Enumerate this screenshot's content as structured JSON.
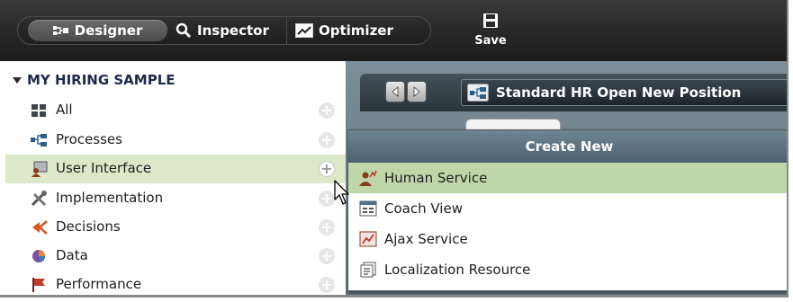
{
  "toolbar": {
    "modes": [
      {
        "label": "Designer",
        "icon": "designer-icon"
      },
      {
        "label": "Inspector",
        "icon": "magnifier-icon"
      },
      {
        "label": "Optimizer",
        "icon": "optimizer-icon"
      }
    ],
    "save_label": "Save"
  },
  "library": {
    "section_title": "MY HIRING SAMPLE",
    "items": [
      {
        "label": "All",
        "icon": "grid-icon"
      },
      {
        "label": "Processes",
        "icon": "process-icon"
      },
      {
        "label": "User Interface",
        "icon": "user-interface-icon"
      },
      {
        "label": "Implementation",
        "icon": "tools-icon"
      },
      {
        "label": "Decisions",
        "icon": "decision-icon"
      },
      {
        "label": "Data",
        "icon": "data-icon"
      },
      {
        "label": "Performance",
        "icon": "flag-icon"
      }
    ],
    "add_symbol": "+"
  },
  "editor": {
    "open_tab_title": "Standard HR Open New Position"
  },
  "create_new": {
    "title": "Create New",
    "items": [
      {
        "label": "Human Service",
        "icon": "human-service-icon"
      },
      {
        "label": "Coach View",
        "icon": "coach-view-icon"
      },
      {
        "label": "Ajax Service",
        "icon": "ajax-service-icon"
      },
      {
        "label": "Localization Resource",
        "icon": "localization-resource-icon"
      }
    ]
  },
  "colors": {
    "toolbar_bg": "#262626",
    "selected_row": "#dbe9c9",
    "menu_highlight": "#bed6a8",
    "popup_header": "#5d7380"
  }
}
